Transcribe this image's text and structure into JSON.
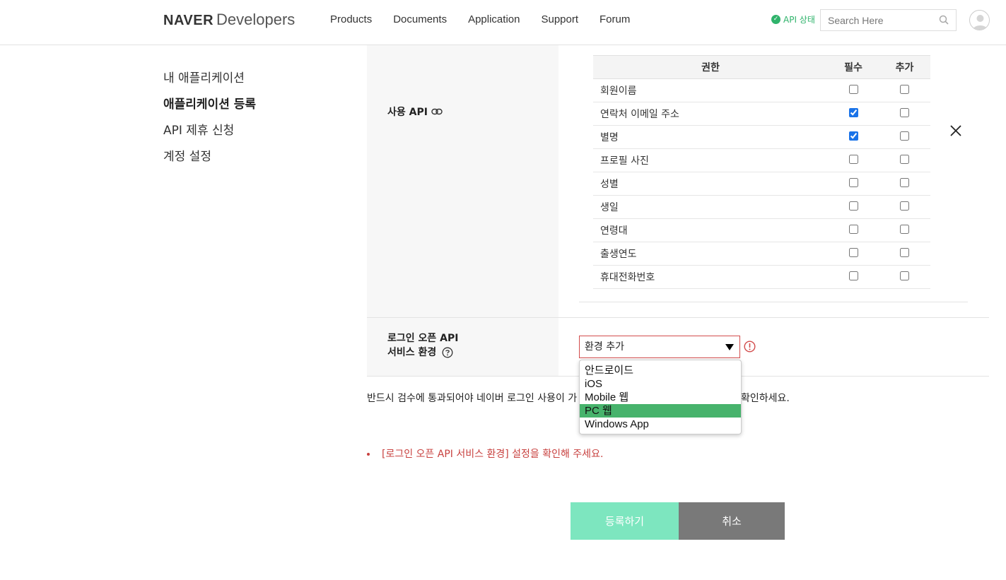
{
  "header": {
    "logo_bold": "NAVER",
    "logo_light": "Developers",
    "nav": [
      "Products",
      "Documents",
      "Application",
      "Support",
      "Forum"
    ],
    "api_status": "API 상태",
    "search_placeholder": "Search Here"
  },
  "sidebar": {
    "items": [
      {
        "label": "내 애플리케이션",
        "active": false
      },
      {
        "label": "애플리케이션 등록",
        "active": true
      },
      {
        "label": "API 제휴 신청",
        "active": false
      },
      {
        "label": "계정 설정",
        "active": false
      }
    ]
  },
  "api_section": {
    "label": "사용 API",
    "headers": {
      "permission": "권한",
      "required": "필수",
      "extra": "추가"
    },
    "rows": [
      {
        "name": "회원이름",
        "required": false,
        "extra": false
      },
      {
        "name": "연락처 이메일 주소",
        "required": true,
        "extra": false
      },
      {
        "name": "별명",
        "required": true,
        "extra": false
      },
      {
        "name": "프로필 사진",
        "required": false,
        "extra": false
      },
      {
        "name": "성별",
        "required": false,
        "extra": false
      },
      {
        "name": "생일",
        "required": false,
        "extra": false
      },
      {
        "name": "연령대",
        "required": false,
        "extra": false
      },
      {
        "name": "출생연도",
        "required": false,
        "extra": false
      },
      {
        "name": "휴대전화번호",
        "required": false,
        "extra": false
      }
    ]
  },
  "env_section": {
    "label_line1": "로그인 오픈 API",
    "label_line2": "서비스 환경",
    "select_value": "환경 추가",
    "options": [
      "안드로이드",
      "iOS",
      "Mobile 웹",
      "PC 웹",
      "Windows App"
    ],
    "highlighted_option": "PC 웹"
  },
  "notice": {
    "text": "반드시 검수에 통과되어야 네이버 로그인 사용이 가",
    "tail": "확인하세요."
  },
  "error": "[로그인 오픈 API 서비스 환경] 설정을 확인해 주세요.",
  "buttons": {
    "register": "등록하기",
    "cancel": "취소"
  },
  "colors": {
    "accent_green": "#47b36c",
    "register_bg": "#7de6bf",
    "cancel_bg": "#797979",
    "error_red": "#c8413f"
  }
}
